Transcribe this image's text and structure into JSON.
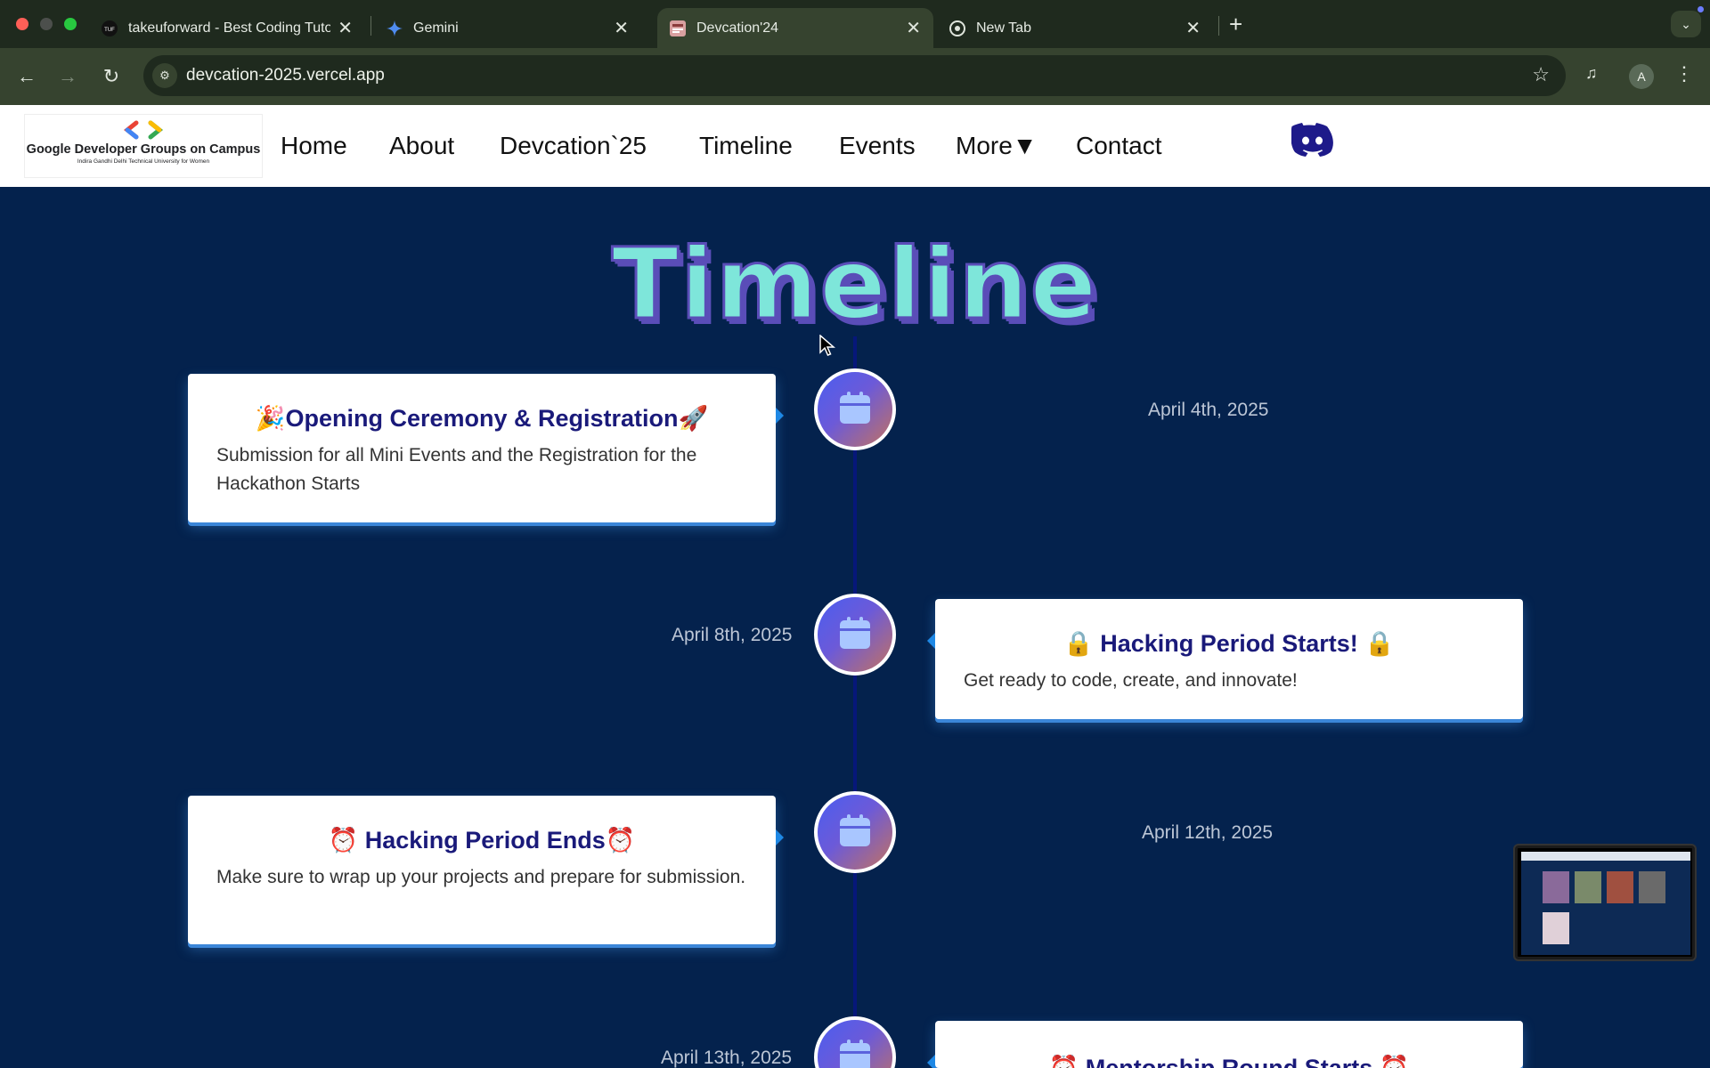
{
  "browser": {
    "tabs": [
      {
        "title": "takeuforward - Best Coding Tutorials",
        "favicon": "tuf-icon"
      },
      {
        "title": "Gemini",
        "favicon": "gemini-icon"
      },
      {
        "title": "Devcation'24",
        "favicon": "devcation-icon",
        "active": true
      },
      {
        "title": "New Tab",
        "favicon": "chrome-icon"
      }
    ],
    "url": "devcation-2025.vercel.app",
    "profile_initial": "A"
  },
  "site": {
    "logo": {
      "name": "Google Developer Groups on Campus",
      "sub": "Indira Gandhi Delhi Technical University for Women"
    },
    "nav": [
      "Home",
      "About",
      "Devcation`25",
      "Timeline",
      "Events",
      "More▼",
      "Contact"
    ]
  },
  "page": {
    "title": "Timeline",
    "events": [
      {
        "title": "🎉Opening Ceremony & Registration🚀",
        "desc": "Submission for all Mini Events and the Registration for the Hackathon Starts",
        "date": "April 4th, 2025"
      },
      {
        "title": "🔒 Hacking Period Starts! 🔒",
        "desc": "Get ready to code, create, and innovate!",
        "date": "April 8th, 2025"
      },
      {
        "title": "⏰ Hacking Period Ends⏰",
        "desc": "Make sure to wrap up your projects and prepare for submission.",
        "date": "April 12th, 2025"
      },
      {
        "title": "⏰ Mentorship Round Starts ⏰",
        "desc": "",
        "date": "April 13th, 2025"
      }
    ]
  },
  "colors": {
    "page_bg": "#04224d",
    "timeline_line": "#06177a",
    "title_fill": "#7ee6da",
    "title_outline": "#5a4db8",
    "card_title": "#1a1a7a"
  }
}
